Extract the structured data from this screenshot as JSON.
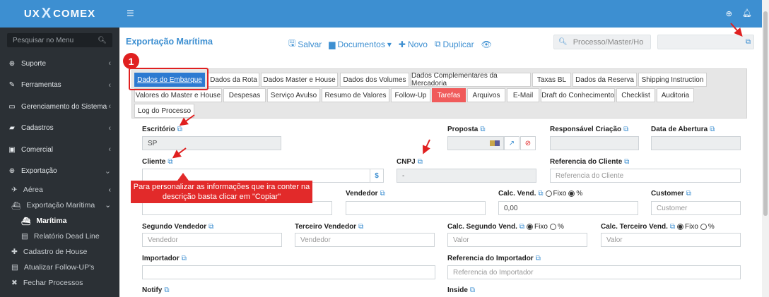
{
  "brand": {
    "left": "UX",
    "x": "X",
    "right": "COMEX"
  },
  "sidebar": {
    "search_placeholder": "Pesquisar no Menu",
    "items": [
      {
        "label": "Suporte",
        "icon": "globe-icon",
        "glyph": "⊕"
      },
      {
        "label": "Ferramentas",
        "icon": "wrench-icon",
        "glyph": "✎"
      },
      {
        "label": "Gerenciamento do Sistema",
        "icon": "laptop-icon",
        "glyph": "▭"
      },
      {
        "label": "Cadastros",
        "icon": "book-icon",
        "glyph": "▰"
      },
      {
        "label": "Comercial",
        "icon": "briefcase-icon",
        "glyph": "▣"
      },
      {
        "label": "Exportação",
        "icon": "globe-icon",
        "glyph": "⊕"
      }
    ],
    "subitems": {
      "aerea": "Aérea",
      "maritima_group": "Exportação Marítima",
      "maritima": "Marítima",
      "dead_line": "Relatório Dead Line",
      "cadastro_house": "Cadastro de House",
      "atualizar": "Atualizar Follow-UP's",
      "fechar": "Fechar Processos"
    }
  },
  "header": {
    "title": "Exportação Marítima"
  },
  "toolbar": {
    "save": "Salvar",
    "documents": "Documentos",
    "new": "Novo",
    "duplicate": "Duplicar"
  },
  "search": {
    "placeholder": "Processo/Master/Ho",
    "value": ""
  },
  "tabs_row1": [
    "Dados do Embarque",
    "Dados da Rota",
    "Dados Master e House",
    "Dados dos Volumes",
    "Dados Complementares da Mercadoria",
    "Taxas BL",
    "Dados da Reserva",
    "Shipping Instruction"
  ],
  "tabs_row2": [
    "Valores do Master e House",
    "Despesas",
    "Serviço Avulso",
    "Resumo de Valores",
    "Follow-Up",
    "Tarefas",
    "Arquivos",
    "E-Mail",
    "Draft do Conhecimento",
    "Checklist",
    "Auditoria"
  ],
  "tabs_row3": [
    "Log do Processo"
  ],
  "form": {
    "escritorio_label": "Escritório",
    "escritorio_value": "SP",
    "proposta_label": "Proposta",
    "responsavel_label": "Responsável Criação",
    "data_abertura_label": "Data de Abertura",
    "cliente_label": "Cliente",
    "cnpj_label": "CNPJ",
    "cnpj_value": "-",
    "referencia_cliente_label": "Referencia do Cliente",
    "referencia_cliente_placeholder": "Referencia do Cliente",
    "vendedor_label": "Vendedor",
    "calc_vend_label": "Calc. Vend.",
    "calc_vend_value": "0,00",
    "customer_label": "Customer",
    "customer_placeholder": "Customer",
    "segundo_vendedor_label": "Segundo Vendedor",
    "segundo_vendedor_placeholder": "Vendedor",
    "terceiro_vendedor_label": "Terceiro Vendedor",
    "terceiro_vendedor_placeholder": "Vendedor",
    "calc_segundo_label": "Calc. Segundo Vend.",
    "calc_terceiro_label": "Calc. Terceiro Vend.",
    "valor_placeholder": "Valor",
    "importador_label": "Importador",
    "referencia_importador_label": "Referencia do Importador",
    "referencia_importador_placeholder": "Referencia do Importador",
    "notify_label": "Notify",
    "inside_label": "Inside",
    "fixo": "Fixo",
    "percent": "%",
    "dollar": "$"
  },
  "annotation": {
    "step": "1",
    "tooltip": "Para personalizar as informações que ira conter na descrição basta clicar em \"Copiar\""
  },
  "colors": {
    "primary": "#3d8fd1",
    "sidebar": "#2b3035",
    "annotation": "#e02020",
    "tab_active": "#2d7ad1",
    "tab_red": "#f05b5b"
  }
}
